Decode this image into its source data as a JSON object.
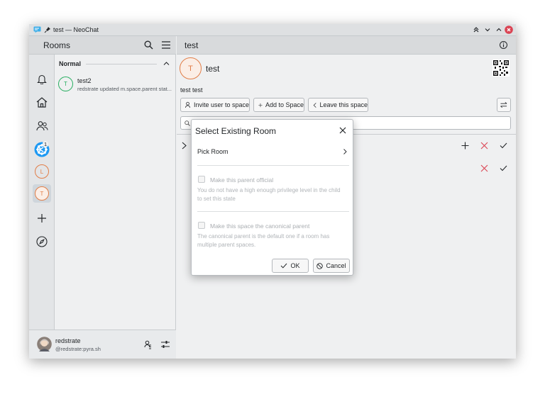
{
  "window": {
    "title": "test — NeoChat"
  },
  "rooms_header": {
    "title": "Rooms"
  },
  "main_header": {
    "title": "test"
  },
  "rooms_list": {
    "section": "Normal",
    "items": [
      {
        "avatar_letter": "T",
        "name": "test2",
        "last_message": "redstrate updated m.space.parent stat..."
      }
    ]
  },
  "rail": {
    "space_badge": "1",
    "avatars": [
      {
        "letter": "L"
      },
      {
        "letter": "T"
      }
    ]
  },
  "space": {
    "avatar_letter": "T",
    "name": "test",
    "topic": "test test",
    "buttons": {
      "invite": "Invite user to space",
      "add": "Add to Space",
      "leave": "Leave this space"
    }
  },
  "user": {
    "name": "redstrate",
    "id": "@redstrate:pyra.sh"
  },
  "dialog": {
    "title": "Select Existing Room",
    "pick_room": "Pick Room",
    "official_label": "Make this parent official",
    "official_desc": "You do not have a high enough privilege level in the child to set this state",
    "canonical_label": "Make this space the canonical parent",
    "canonical_desc": "The canonical parent is the default one if a room has multiple parent spaces.",
    "ok": "OK",
    "cancel": "Cancel"
  },
  "colors": {
    "accent": "#3daee9",
    "danger": "#da4453",
    "orange_avatar": "#e17e48",
    "green_avatar": "#27ae60"
  }
}
